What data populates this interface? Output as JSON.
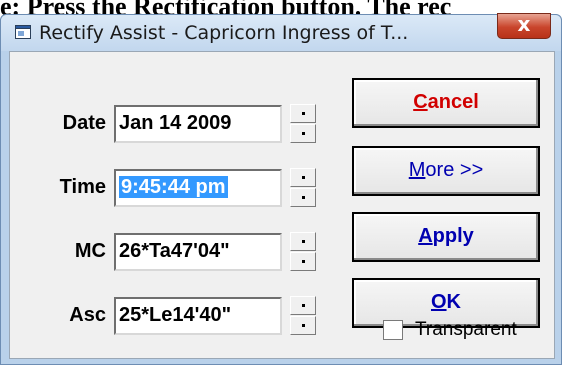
{
  "background_text": "e: Press the Rectification button. The rec",
  "window": {
    "title": "Rectify Assist - Capricorn Ingress of T...",
    "close_symbol": "x"
  },
  "fields": [
    {
      "label": "Date",
      "value": "Jan 14 2009"
    },
    {
      "label": "Time",
      "value": "9:45:44 pm"
    },
    {
      "label": "MC",
      "value": "26*Ta47'04\""
    },
    {
      "label": "Asc",
      "value": "25*Le14'40\""
    }
  ],
  "buttons": {
    "cancel": {
      "first": "C",
      "rest": "ancel"
    },
    "more": {
      "first": "M",
      "rest": "ore >>"
    },
    "apply": {
      "first": "A",
      "rest": "pply"
    },
    "ok": {
      "first": "O",
      "rest": "K"
    }
  },
  "transparent": {
    "label": "Transparent",
    "checked": false
  },
  "colors": {
    "cancel": "#d10000",
    "accent": "#0000b0",
    "selection": "#3399ff"
  }
}
